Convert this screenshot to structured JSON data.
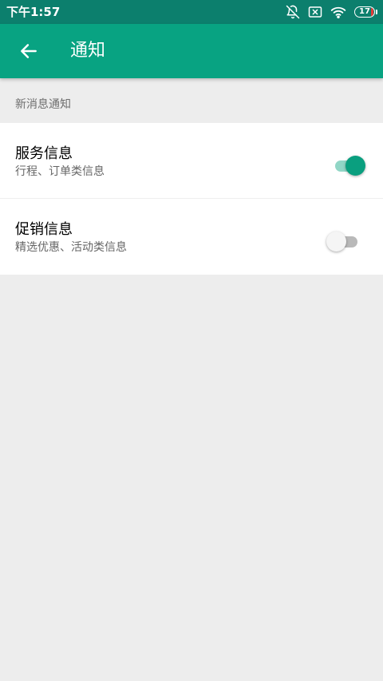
{
  "status_bar": {
    "time": "下午1:57",
    "icons": [
      "notifications-off-icon",
      "sim-card-x-icon",
      "wifi-icon",
      "battery-icon"
    ],
    "battery_level": "17",
    "battery_low_color": "#e53935",
    "background": "#0c7f6d"
  },
  "app_bar": {
    "back_icon": "arrow-left-icon",
    "title": "通知",
    "background": "#08a382"
  },
  "section": {
    "header": "新消息通知"
  },
  "settings": [
    {
      "title": "服务信息",
      "subtitle": "行程、订单类信息",
      "enabled": true
    },
    {
      "title": "促销信息",
      "subtitle": "精选优惠、活动类信息",
      "enabled": false
    }
  ],
  "colors": {
    "accent": "#0a9f7f",
    "track_on": "#91d6c6",
    "track_off": "#b9b9b9",
    "page_background": "#ededed"
  }
}
